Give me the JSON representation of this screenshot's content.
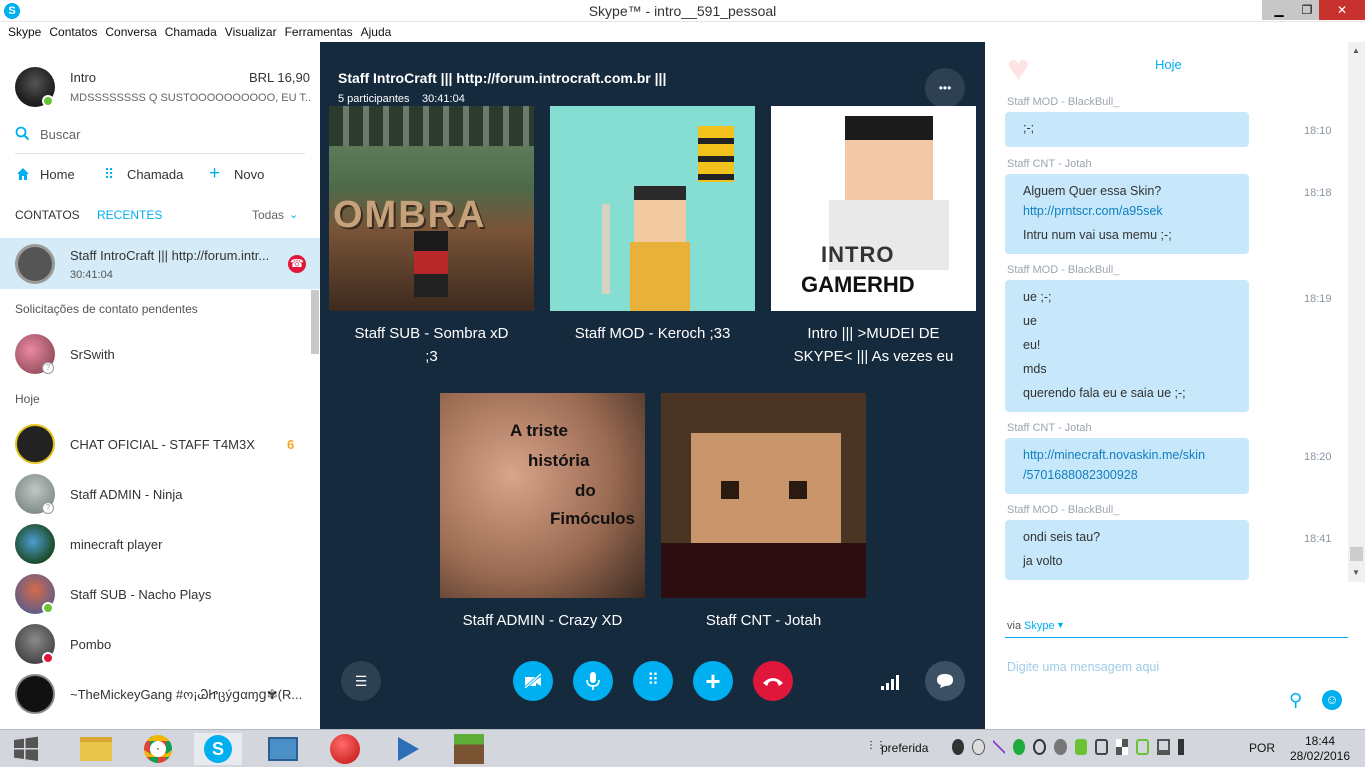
{
  "window": {
    "title": "Skype™ - intro__591_pessoal",
    "minimize": "▁",
    "maximize": "❐",
    "close": "✕"
  },
  "menu": [
    "Skype",
    "Contatos",
    "Conversa",
    "Chamada",
    "Visualizar",
    "Ferramentas",
    "Ajuda"
  ],
  "profile": {
    "name": "Intro",
    "balance": "BRL 16,90",
    "mood": "MDSSSSSSSS Q SUSTOOOOOOOOOO, EU T..."
  },
  "search": {
    "placeholder": "Buscar"
  },
  "nav": {
    "home": "Home",
    "call": "Chamada",
    "new": "Novo"
  },
  "tabs": {
    "contacts": "CONTATOS",
    "recent": "RECENTES",
    "filter": "Todas"
  },
  "active_call": {
    "name": "Staff IntroCraft ||| http://forum.intr...",
    "duration": "30:41:04"
  },
  "pending_label": "Solicitações de contato pendentes",
  "pending": [
    {
      "name": "SrSwith"
    }
  ],
  "today_label": "Hoje",
  "recents": [
    {
      "name": "CHAT OFICIAL - STAFF T4M3X",
      "badge": "6"
    },
    {
      "name": "Staff ADMIN - Ninja"
    },
    {
      "name": "minecraft player"
    },
    {
      "name": "Staff SUB - Nacho Plays"
    },
    {
      "name": "Pombo"
    },
    {
      "name": "~TheMickeyGang  #ო¡ᏊᏥცýցαɱց✾(R..."
    }
  ],
  "call": {
    "title": "Staff IntroCraft ||| http://forum.introcraft.com.br |||",
    "participants": "5 participantes",
    "duration": "30:41:04",
    "more": "•••",
    "tiles": [
      {
        "label_1": "Staff SUB - Sombra xD",
        "label_2": ";3"
      },
      {
        "label_1": "Staff MOD - Keroch ;33",
        "label_2": ""
      },
      {
        "label_1": "Intro ||| >MUDEI DE",
        "label_2": "SKYPE< ||| As vezes eu"
      },
      {
        "label_1": "Staff ADMIN - Crazy XD",
        "label_2": ""
      },
      {
        "label_1": "Staff CNT - Jotah",
        "label_2": ""
      }
    ],
    "tile_texts": {
      "sombra": "OMBRA",
      "intro": "INTRO",
      "gamer": "GAMERHD",
      "crazy_1": "A triste",
      "crazy_2": "história",
      "crazy_3": "do",
      "crazy_4": "Fimóculos"
    }
  },
  "chat": {
    "date": "Hoje",
    "messages": [
      {
        "sender": "Staff MOD - BlackBull_",
        "time": "18:10",
        "lines": [
          ";-;"
        ]
      },
      {
        "sender": "Staff CNT - Jotah",
        "time": "18:18",
        "lines": [
          "Alguem Quer essa Skin?",
          "http://prntscr.com/a95sek",
          "Intru num vai usa memu ;-;"
        ]
      },
      {
        "sender": "Staff MOD - BlackBull_",
        "time": "18:19",
        "lines": [
          "ue ;-;",
          "ue",
          "eu!",
          "mds",
          "querendo fala eu e saia ue ;-;"
        ]
      },
      {
        "sender": "Staff CNT - Jotah",
        "time": "18:20",
        "lines": [
          "http://minecraft.novaskin.me/skin",
          "/5701688082300928"
        ]
      },
      {
        "sender": "Staff MOD - BlackBull_",
        "time": "18:41",
        "lines": [
          "ondi seis tau?",
          "ja volto"
        ]
      }
    ],
    "via": "via",
    "via_app": "Skype",
    "input_placeholder": "Digite uma mensagem aqui"
  },
  "taskbar": {
    "tray_label": "preferida",
    "lang": "POR",
    "time": "18:44",
    "date": "28/02/2016"
  },
  "colors": {
    "skype_blue": "#00aff0",
    "sidebar_active": "#d5ebf7",
    "call_bg": "#162a3d",
    "bubble": "#c7e7fa",
    "end_call": "#e0173a"
  }
}
